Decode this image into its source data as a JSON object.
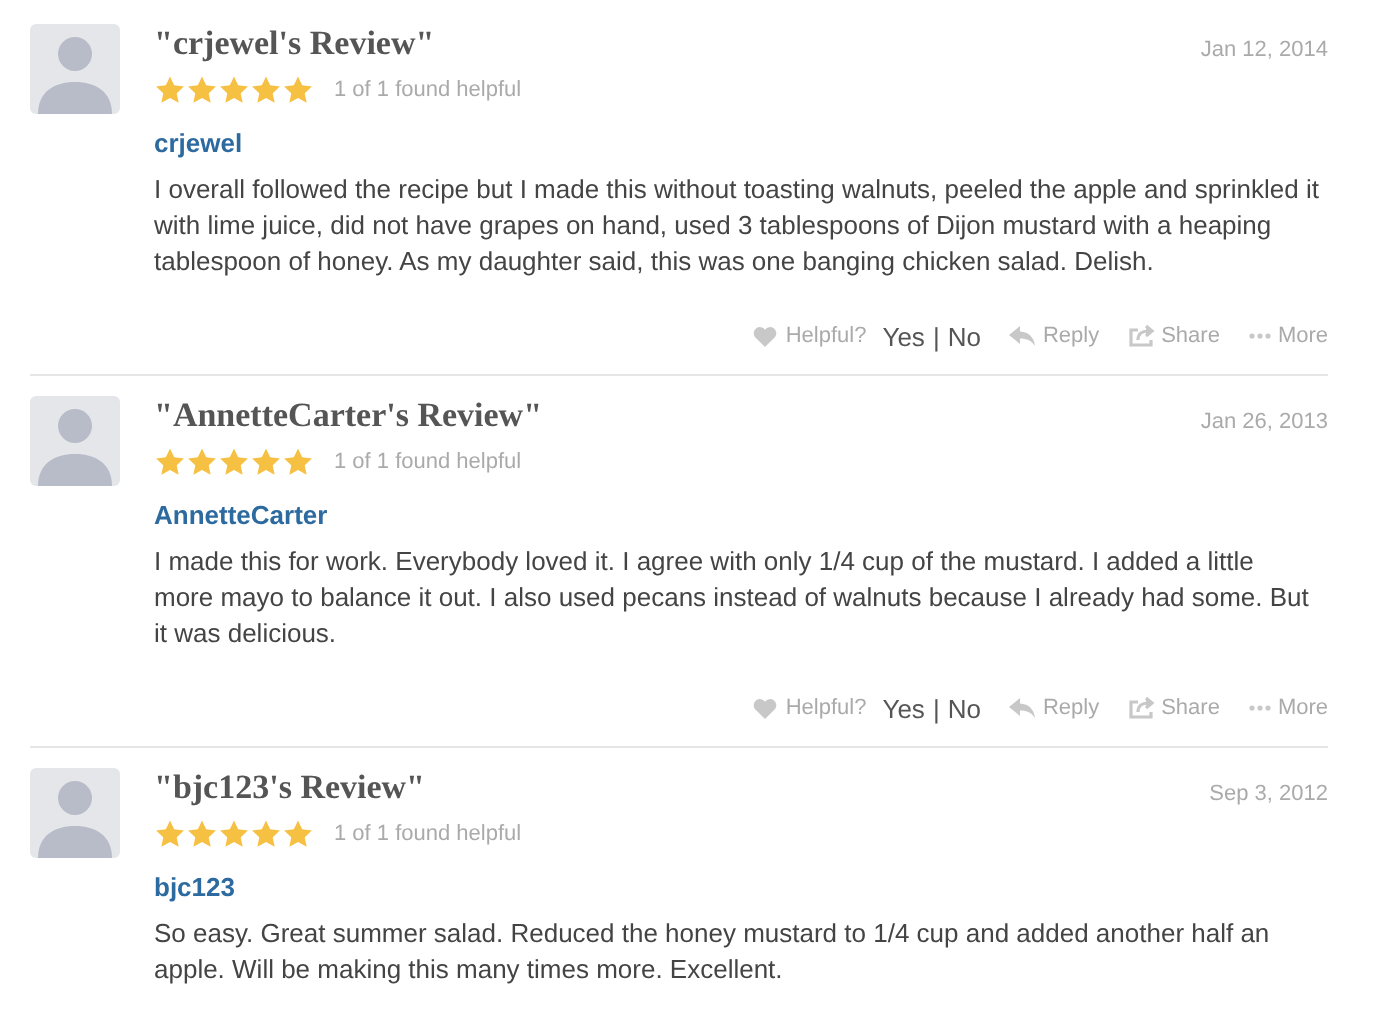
{
  "reviews": [
    {
      "title": "\"crjewel's Review\"",
      "date": "Jan 12, 2014",
      "stars": 5,
      "helpful_count": "1 of 1 found helpful",
      "author": "crjewel",
      "body": "I overall followed the recipe but I made this without toasting walnuts, peeled the apple and sprinkled it with lime juice, did not have grapes on hand, used 3 tablespoons of Dijon mustard with a heaping tablespoon of honey. As my daughter said, this was one banging chicken salad. Delish.",
      "actions": {
        "helpful": "Helpful?",
        "yes": "Yes",
        "separator": "|",
        "no": "No",
        "reply": "Reply",
        "share": "Share",
        "more": "More"
      }
    },
    {
      "title": "\"AnnetteCarter's Review\"",
      "date": "Jan 26, 2013",
      "stars": 5,
      "helpful_count": "1 of 1 found helpful",
      "author": "AnnetteCarter",
      "body": "I made this for work. Everybody loved it. I agree with only 1/4 cup of the mustard. I added a little more mayo to balance it out. I also used pecans instead of walnuts because I already had some. But it was delicious.",
      "actions": {
        "helpful": "Helpful?",
        "yes": "Yes",
        "separator": "|",
        "no": "No",
        "reply": "Reply",
        "share": "Share",
        "more": "More"
      }
    },
    {
      "title": "\"bjc123's Review\"",
      "date": "Sep 3, 2012",
      "stars": 5,
      "helpful_count": "1 of 1 found helpful",
      "author": "bjc123",
      "body": "So easy. Great summer salad. Reduced the honey mustard to 1/4 cup and added another half an apple. Will be making this many times more. Excellent."
    }
  ]
}
